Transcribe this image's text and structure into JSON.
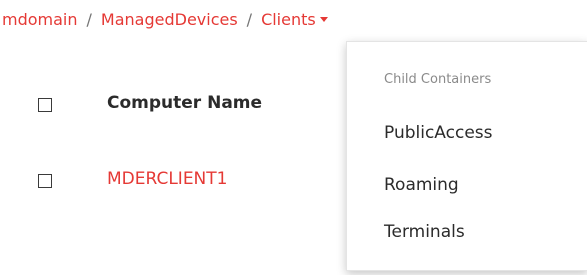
{
  "breadcrumb": {
    "items": [
      {
        "label": "mdomain"
      },
      {
        "label": "ManagedDevices"
      },
      {
        "label": "Clients"
      }
    ],
    "separator": "/"
  },
  "table": {
    "columns": [
      "Computer Name"
    ],
    "rows": [
      {
        "computer_name": "MDERCLIENT1"
      }
    ]
  },
  "dropdown": {
    "header": "Child Containers",
    "items": [
      "PublicAccess",
      "Roaming",
      "Terminals"
    ]
  },
  "colors": {
    "accent": "#e53935",
    "text": "#2b2b2b",
    "muted": "#8a8a8a"
  }
}
